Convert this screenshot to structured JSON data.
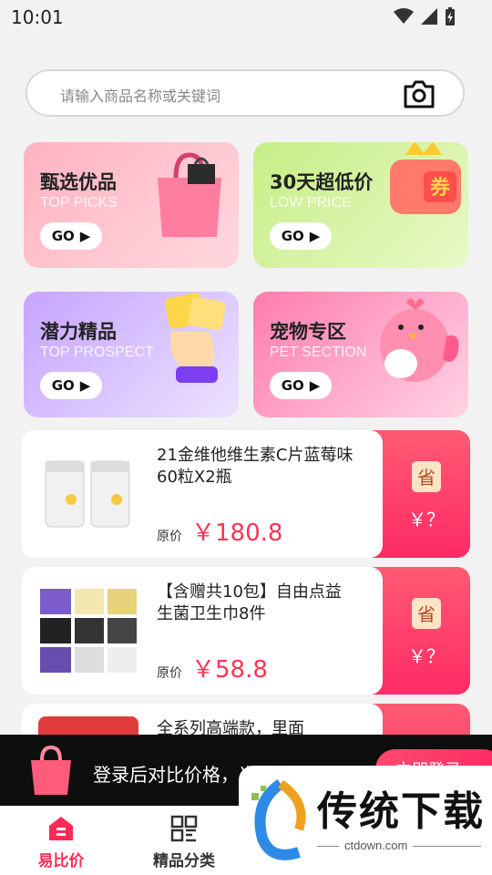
{
  "status": {
    "time": "10:01"
  },
  "search": {
    "placeholder": "请输入商品名称或关键词",
    "icon": "camera-icon"
  },
  "categories": [
    {
      "title": "甄选优品",
      "subtitle": "TOP PICKS",
      "go": "GO",
      "icon": "shopping-bag-art",
      "colors": [
        "#ff8fa3",
        "#ffcdd5"
      ]
    },
    {
      "title": "30天超低价",
      "subtitle": "LOW PRICE",
      "go": "GO",
      "icon": "coupon-art",
      "colors": [
        "#b7e86a",
        "#e3f7b6"
      ]
    },
    {
      "title": "潜力精品",
      "subtitle": "TOP PROSPECT",
      "go": "GO",
      "icon": "hand-stars-art",
      "colors": [
        "#b48cff",
        "#e6d8ff"
      ]
    },
    {
      "title": "宠物专区",
      "subtitle": "PET SECTION",
      "go": "GO",
      "icon": "pink-bird-art",
      "colors": [
        "#ff5f9a",
        "#ffd0e3"
      ]
    }
  ],
  "products": [
    {
      "name": "21金维他维生素C片蓝莓味60粒X2瓶",
      "price_label": "原价",
      "price": "￥180.8",
      "save_icon": "省",
      "save_price": "￥？"
    },
    {
      "name": "【含赠共10包】自由点益生菌卫生巾8件",
      "price_label": "原价",
      "price": "￥58.8",
      "save_icon": "省",
      "save_price": "￥？"
    },
    {
      "name": "全系列高端款，里面"
    }
  ],
  "banner": {
    "text": "登录后对比价格，当乎更省钱",
    "button": "立即登录"
  },
  "tabs": [
    {
      "label": "易比价",
      "icon": "home-price-icon",
      "active": true
    },
    {
      "label": "精品分类",
      "icon": "grid-category-icon",
      "active": false
    }
  ],
  "watermark": {
    "title": "传统下载",
    "url": "ctdown.com"
  },
  "colors": {
    "accent": "#ff3355",
    "active_tab": "#ff2b55"
  }
}
